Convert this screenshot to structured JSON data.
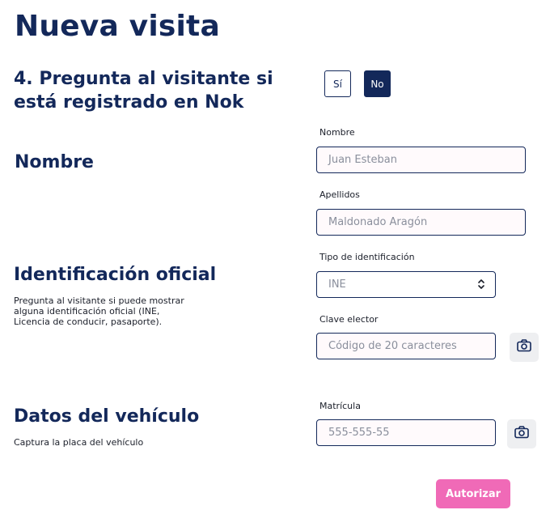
{
  "page": {
    "title": "Nueva visita"
  },
  "question": {
    "text_line1": "4. Pregunta al visitante si",
    "text_line2": "está registrado en Nok",
    "yes_label": "Sí",
    "no_label": "No",
    "selected": "No"
  },
  "nombre": {
    "section_title": "Nombre",
    "first_name_label": "Nombre",
    "first_name_placeholder": "Juan Esteban",
    "last_name_label": "Apellidos",
    "last_name_placeholder": "Maldonado Aragón"
  },
  "identificacion": {
    "section_title": "Identificación oficial",
    "description_line1": "Pregunta al visitante si puede mostrar",
    "description_line2": "alguna identificación oficial (INE,",
    "description_line3": "Licencia de conducir, pasaporte).",
    "type_label": "Tipo de identificación",
    "type_value": "INE",
    "key_label": "Clave elector",
    "key_placeholder": "Código de 20 caracteres",
    "camera_icon": "camera-icon"
  },
  "vehiculo": {
    "section_title": "Datos del vehículo",
    "description": "Captura la placa del vehículo",
    "plate_label": "Matrícula",
    "plate_placeholder": "555-555-55",
    "camera_icon": "camera-icon"
  },
  "actions": {
    "authorize_label": "Autorizar"
  },
  "colors": {
    "primary": "#13285a",
    "accent": "#f06ab7",
    "input_bg": "#fffafc",
    "camera_bg": "#eeeff1"
  }
}
